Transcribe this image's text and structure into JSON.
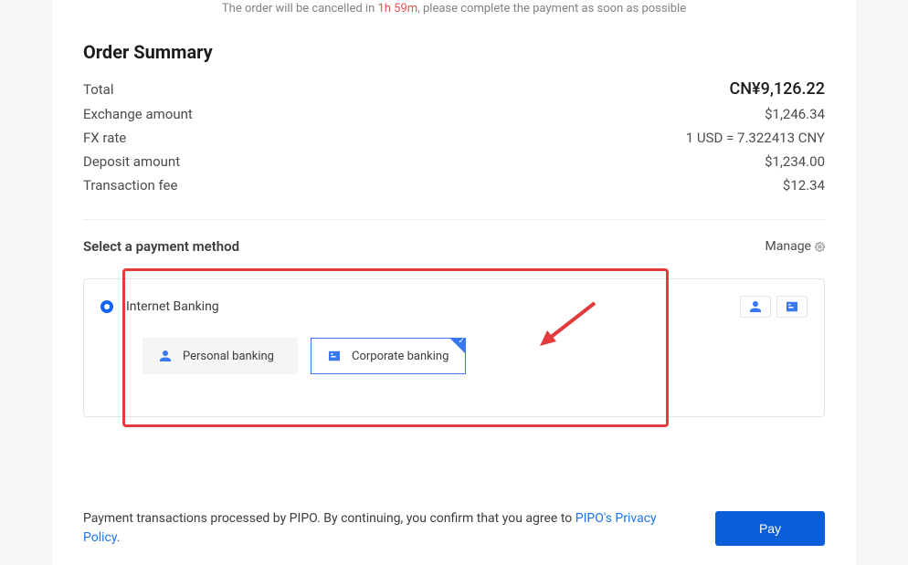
{
  "warning": {
    "prefix": "The order will be cancelled in ",
    "time": "1h 59m",
    "suffix": ", please complete the payment as soon as possible"
  },
  "summary": {
    "title": "Order Summary",
    "rows": [
      {
        "label": "Total",
        "value": "CN¥9,126.22"
      },
      {
        "label": "Exchange amount",
        "value": "$1,246.34"
      },
      {
        "label": "FX rate",
        "value": "1 USD = 7.322413 CNY"
      },
      {
        "label": "Deposit amount",
        "value": "$1,234.00"
      },
      {
        "label": "Transaction fee",
        "value": "$12.34"
      }
    ]
  },
  "payment": {
    "select_title": "Select a payment method",
    "manage": "Manage",
    "method_name": "Internet Banking",
    "options": {
      "personal": "Personal banking",
      "corporate": "Corporate banking"
    }
  },
  "footer": {
    "disclosure_prefix": "Payment transactions processed by PIPO. By continuing, you confirm that you agree to ",
    "policy_text": "PIPO's Privacy Policy",
    "period": ".",
    "pay_button": "Pay"
  }
}
